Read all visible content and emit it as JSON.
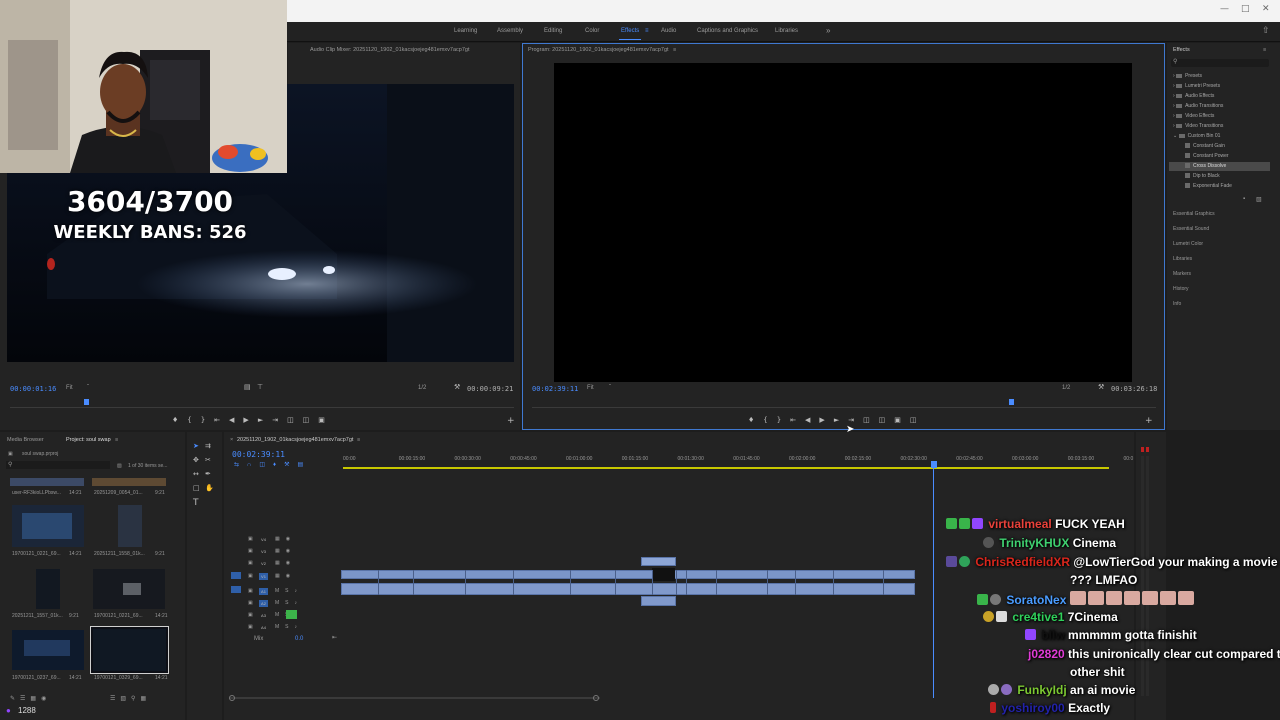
{
  "workspaces": [
    {
      "label": "Learning",
      "active": false
    },
    {
      "label": "Assembly",
      "active": false
    },
    {
      "label": "Editing",
      "active": false
    },
    {
      "label": "Color",
      "active": false
    },
    {
      "label": "Effects",
      "active": true
    },
    {
      "label": "Audio",
      "active": false
    },
    {
      "label": "Captions and Graphics",
      "active": false
    },
    {
      "label": "Libraries",
      "active": false
    }
  ],
  "source_monitor": {
    "tab": "Audio Clip Mixer: 20251120_1902_01kacsjoejeg481emxv7acp7gt",
    "timecode": "00:00:01:16",
    "fit": "Fit",
    "ratio": "1/2",
    "duration": "00:00:09:21"
  },
  "program_monitor": {
    "tab": "Program: 20251120_1902_01kacsjoejeg481emxv7acp7gt",
    "timecode": "00:02:39:11",
    "fit": "Fit",
    "ratio": "1/2",
    "duration": "00:03:26:18"
  },
  "overlay": {
    "counter": "3604/3700",
    "weekly_bans": "WEEKLY BANS: 526"
  },
  "effects_panel": {
    "title": "Effects",
    "tree": [
      "Presets",
      "Lumetri Presets",
      "Audio Effects",
      "Audio Transitions",
      "Video Effects",
      "Video Transitions",
      "Custom Bin 01"
    ],
    "custom_items": [
      "Constant Gain",
      "Constant Power",
      "Cross Dissolve",
      "Dip to Black",
      "Exponential Fade"
    ],
    "sections": [
      "Essential Graphics",
      "Essential Sound",
      "Lumetri Color",
      "Libraries",
      "Markers",
      "History",
      "Info"
    ]
  },
  "project_panel": {
    "tabs": [
      "Media Browser",
      "Project: soul swap"
    ],
    "file": "soul swap.prproj",
    "count": "1 of 30 items se...",
    "items": [
      {
        "name": "user-RF3kioLLPbsw...",
        "dur": "14:21"
      },
      {
        "name": "20251209_0054_01...",
        "dur": "9:21"
      },
      {
        "name": "19700121_0221_69...",
        "dur": "14:21"
      },
      {
        "name": "20251211_1558_01k...",
        "dur": "9:21"
      },
      {
        "name": "20251211_1557_01k...",
        "dur": "9:21"
      },
      {
        "name": "19700121_0221_69...",
        "dur": "14:21"
      },
      {
        "name": "19700121_0237_69...",
        "dur": "14:21"
      },
      {
        "name": "19700121_0329_69...",
        "dur": "14:21"
      }
    ]
  },
  "timeline": {
    "tab": "20251120_1902_01kacsjoejeg481emxv7acp7gt",
    "timecode": "00:02:39:11",
    "ruler": [
      "00:00",
      "00:00:15:00",
      "00:00:30:00",
      "00:00:45:00",
      "00:01:00:00",
      "00:01:15:00",
      "00:01:30:00",
      "00:01:45:00",
      "00:02:00:00",
      "00:02:15:00",
      "00:02:30:00",
      "00:02:45:00",
      "00:03:00:00",
      "00:03:15:00",
      "00:0"
    ],
    "tracks": [
      "V4",
      "V3",
      "V2",
      "V1",
      "A1",
      "A2",
      "A3",
      "A4"
    ],
    "mix_label": "Mix",
    "mix_value": "0.0"
  },
  "chat": [
    {
      "user": "virtualmeal",
      "color": "#e8413a",
      "msg": "FUCK YEAH"
    },
    {
      "user": "TrinityKHUX",
      "color": "#3fd170",
      "msg": "Cinema"
    },
    {
      "user": "ChrisRedfieldXR",
      "color": "#d9261c",
      "msg": "@LowTierGod your making a movie"
    },
    {
      "user": "",
      "color": "#ffffff",
      "msg": "??? LMFAO"
    },
    {
      "user": "SoratoNex",
      "color": "#4a9cff",
      "msg": ""
    },
    {
      "user": "cre4tive1",
      "color": "#2fd05a",
      "msg": "7Cinema"
    },
    {
      "user": "bllw",
      "color": "#111111",
      "msg": "mmmmm gotta finishit"
    },
    {
      "user": "j02820",
      "color": "#e03bd6",
      "msg": "this unironically clear cut compared to"
    },
    {
      "user": "",
      "color": "#ffffff",
      "msg": "other shit"
    },
    {
      "user": "FunkyIdj",
      "color": "#7cc832",
      "msg": "an ai movie"
    },
    {
      "user": "yoshiroy00",
      "color": "#2222aa",
      "msg": "Exactly"
    }
  ],
  "viewer_count": "1288",
  "colors": {
    "accent": "#4a8cff",
    "clip": "#7b96c9",
    "panel": "#232323"
  }
}
